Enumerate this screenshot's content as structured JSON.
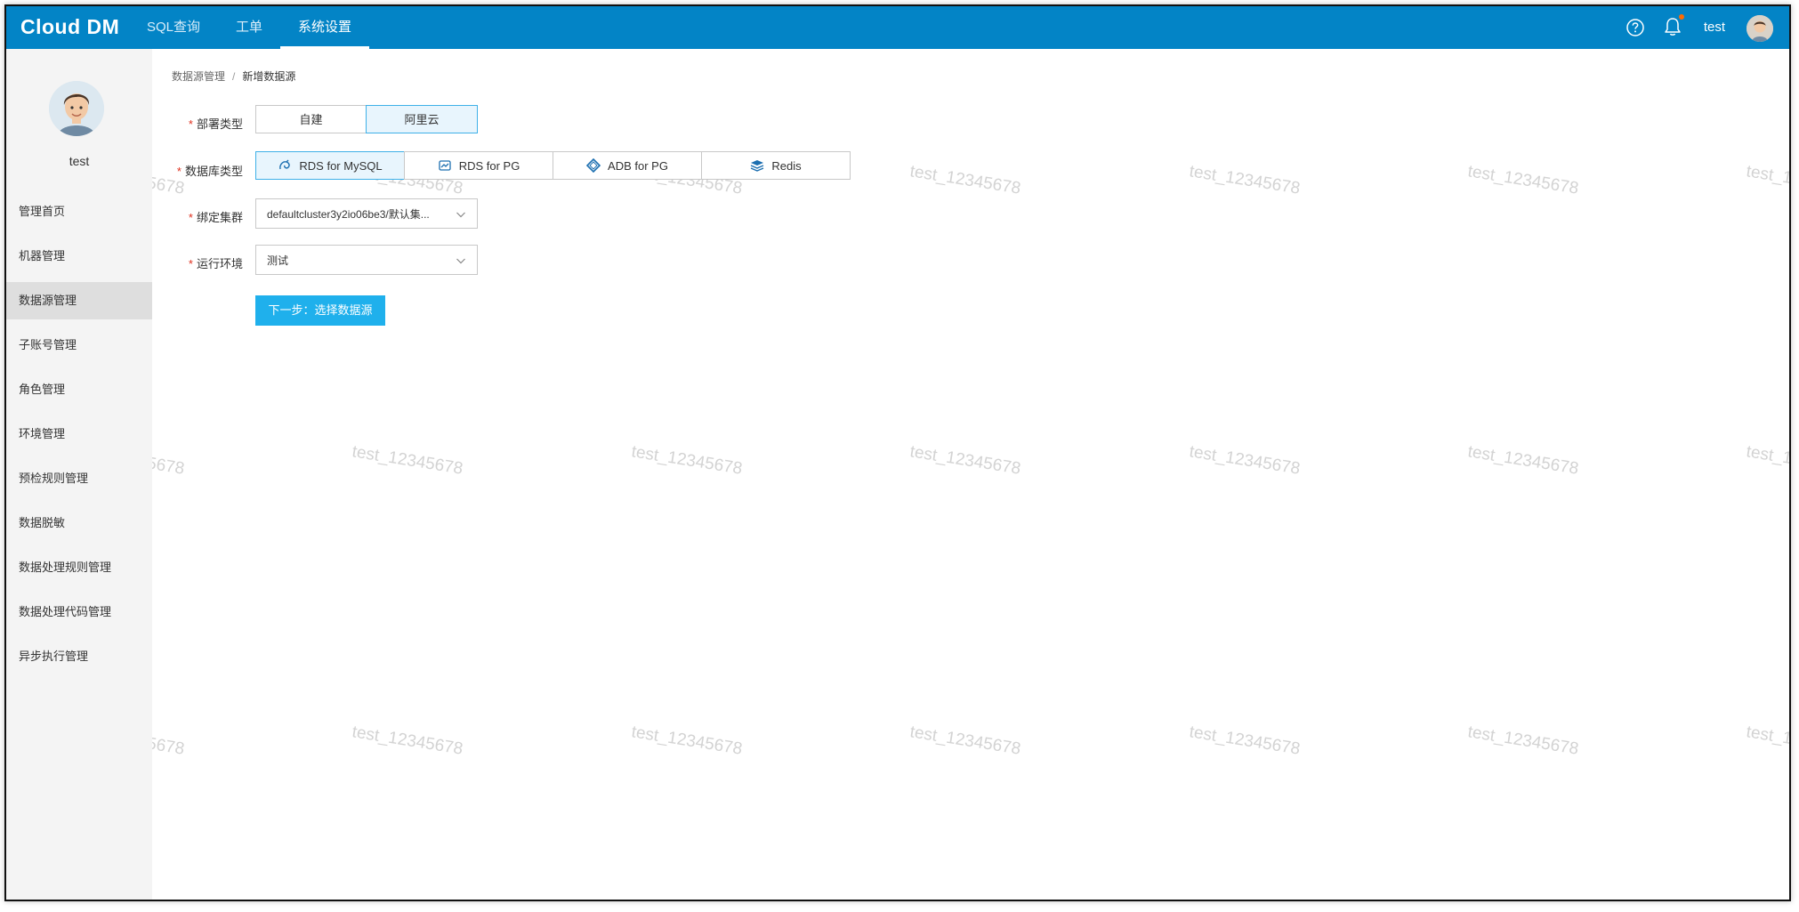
{
  "topbar": {
    "logo": "Cloud DM",
    "nav": [
      "SQL查询",
      "工单",
      "系统设置"
    ],
    "active_nav": "系统设置",
    "user": "test",
    "icons": [
      "help-icon",
      "bell-icon",
      "avatar"
    ]
  },
  "sidebar": {
    "username": "test",
    "items": [
      "管理首页",
      "机器管理",
      "数据源管理",
      "子账号管理",
      "角色管理",
      "环境管理",
      "预检规则管理",
      "数据脱敏",
      "数据处理规则管理",
      "数据处理代码管理",
      "异步执行管理"
    ],
    "active_item": "数据源管理"
  },
  "breadcrumb": {
    "parent": "数据源管理",
    "separator": "/",
    "current": "新增数据源"
  },
  "form": {
    "deploy_type": {
      "label": "部署类型",
      "required_mark": "*",
      "options": [
        "自建",
        "阿里云"
      ],
      "selected": "阿里云"
    },
    "db_type": {
      "label": "数据库类型",
      "required_mark": "*",
      "options": [
        "RDS for MySQL",
        "RDS for PG",
        "ADB for PG",
        "Redis"
      ],
      "selected": "RDS for MySQL"
    },
    "cluster": {
      "label": "绑定集群",
      "required_mark": "*",
      "value": "defaultcluster3y2io06be3/默认集..."
    },
    "environment": {
      "label": "运行环境",
      "required_mark": "*",
      "value": "测试"
    },
    "next_button": "下一步：选择数据源"
  },
  "watermark": "test_12345678",
  "colors": {
    "topbar": "#0384c6",
    "primary_button": "#1fb0ec",
    "selected_bg": "#e8f5fd",
    "selected_border": "#3eb0e8",
    "required": "#e0301e"
  }
}
